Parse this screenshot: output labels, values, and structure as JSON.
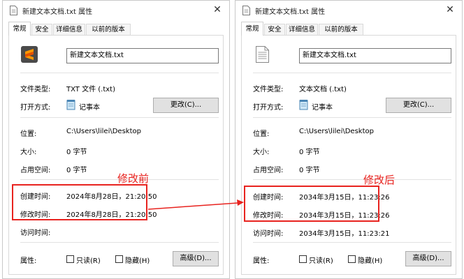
{
  "left": {
    "title": "新建文本文档.txt 属性",
    "tabs": [
      "常规",
      "安全",
      "详细信息",
      "以前的版本"
    ],
    "filename": "新建文本文档.txt",
    "type_label": "文件类型:",
    "type_value": "TXT 文件 (.txt)",
    "open_label": "打开方式:",
    "open_value": "记事本",
    "change_button": "更改(C)...",
    "location_label": "位置:",
    "location_value": "C:\\Users\\lilei\\Desktop",
    "size_label": "大小:",
    "size_value": "0 字节",
    "disk_label": "占用空间:",
    "disk_value": "0 字节",
    "created_label": "创建时间:",
    "created_value": "2024年8月28日，21:20:50",
    "modified_label": "修改时间:",
    "modified_value": "2024年8月28日，21:20:50",
    "accessed_label": "访问时间:",
    "accessed_value": "",
    "attr_label": "属性:",
    "readonly_label": "只读(R)",
    "hidden_label": "隐藏(H)",
    "advanced_button": "高级(D)..."
  },
  "right": {
    "title": "新建文本文档.txt 属性",
    "tabs": [
      "常规",
      "安全",
      "详细信息",
      "以前的版本"
    ],
    "filename": "新建文本文档.txt",
    "type_label": "文件类型:",
    "type_value": "文本文档 (.txt)",
    "open_label": "打开方式:",
    "open_value": "记事本",
    "change_button": "更改(C)...",
    "location_label": "位置:",
    "location_value": "C:\\Users\\lilei\\Desktop",
    "size_label": "大小:",
    "size_value": "0 字节",
    "disk_label": "占用空间:",
    "disk_value": "0 字节",
    "created_label": "创建时间:",
    "created_value": "2034年3月15日，11:23:26",
    "modified_label": "修改时间:",
    "modified_value": "2034年3月15日，11:23:26",
    "accessed_label": "访问时间:",
    "accessed_value": "2034年3月15日，11:23:21",
    "attr_label": "属性:",
    "readonly_label": "只读(R)",
    "hidden_label": "隐藏(H)",
    "advanced_button": "高级(D)..."
  },
  "annotations": {
    "before_label": "修改前",
    "after_label": "修改后",
    "color": "#e8231f"
  },
  "icons": {
    "left_file_icon": "sublime-text-icon",
    "right_file_icon": "text-document-icon",
    "open_with_icon": "notepad-icon"
  }
}
